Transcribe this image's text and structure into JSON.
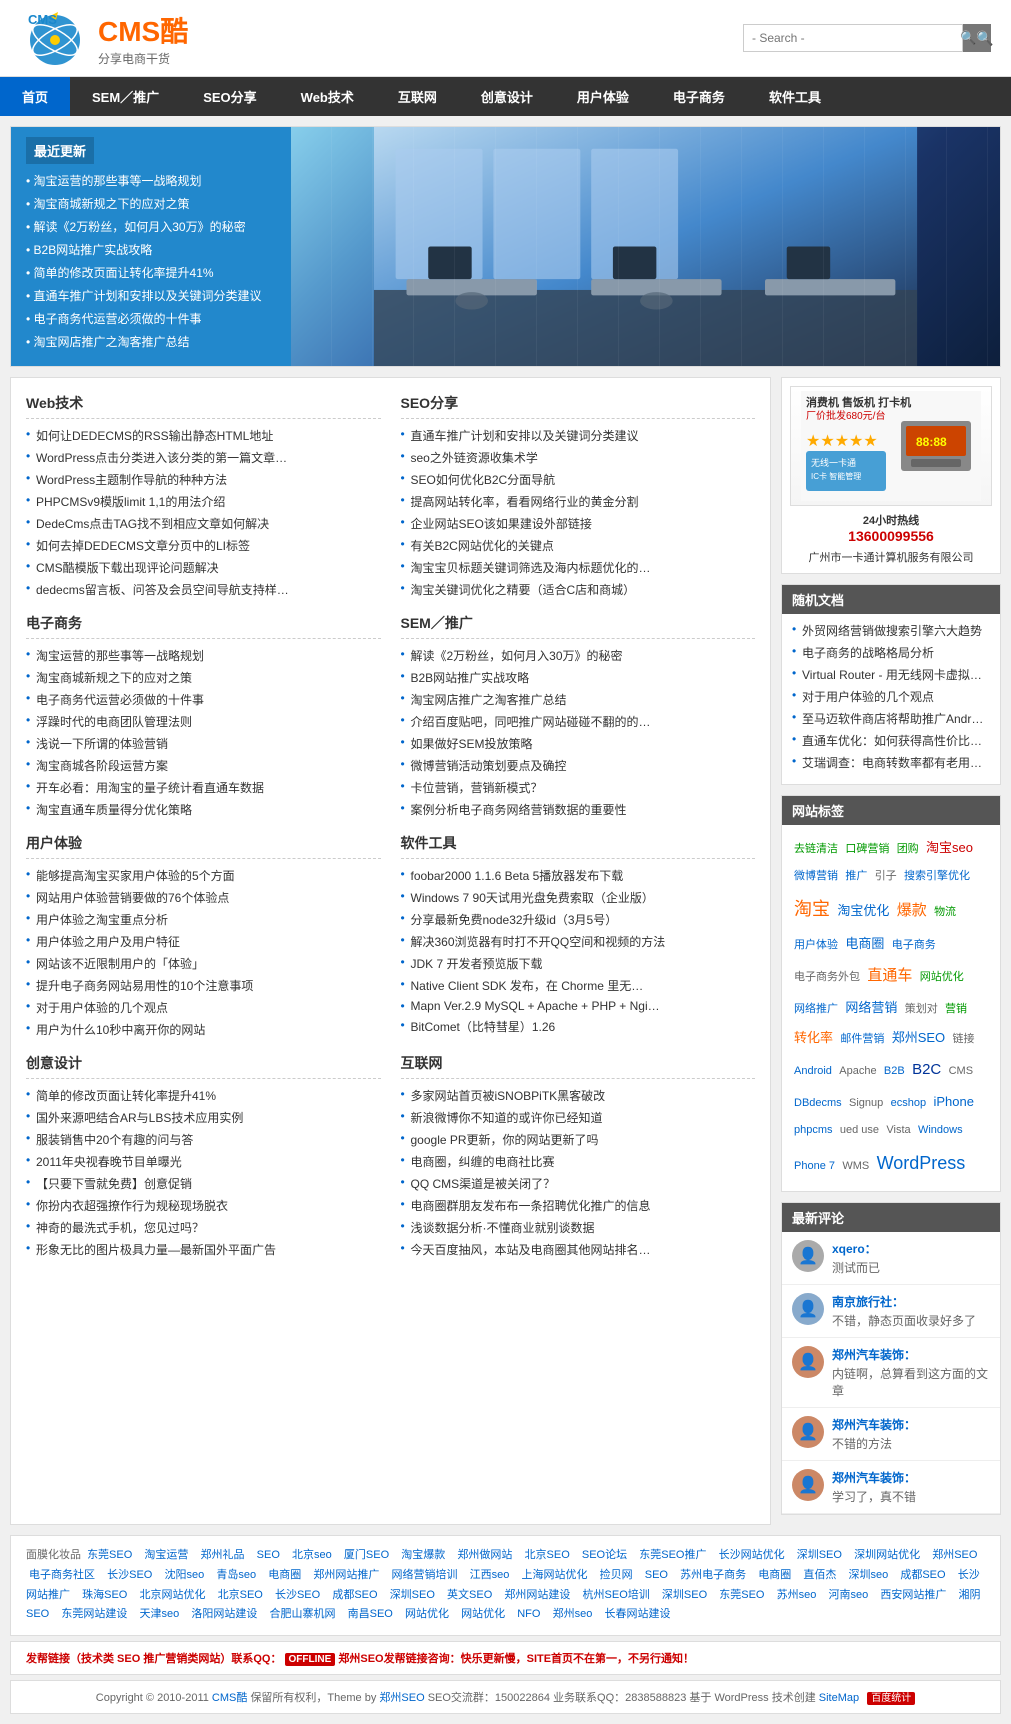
{
  "header": {
    "logo_cms": "CMS",
    "logo_ku": "酷",
    "tagline": "分享电商干货",
    "search_placeholder": "- Search -"
  },
  "nav": {
    "items": [
      {
        "label": "首页",
        "active": true
      },
      {
        "label": "SEM／推广"
      },
      {
        "label": "SEO分享"
      },
      {
        "label": "Web技术"
      },
      {
        "label": "互联网"
      },
      {
        "label": "创意设计"
      },
      {
        "label": "用户体验"
      },
      {
        "label": "电子商务"
      },
      {
        "label": "软件工具"
      }
    ]
  },
  "featured": {
    "section_title": "最近更新",
    "items": [
      "淘宝运营的那些事等一战略规划",
      "淘宝商城新规之下的应对之策",
      "解读《2万粉丝，如何月入30万》的秘密",
      "B2B网站推广实战攻略",
      "简单的修改页面让转化率提升41%",
      "直通车推广计划和安排以及关键词分类建议",
      "电子商务代运营必须做的十件事",
      "淘宝网店推广之淘客推广总结"
    ]
  },
  "sections": {
    "web_tech": {
      "title": "Web技术",
      "items": [
        "如何让DEDECMS的RSS输出静态HTML地址",
        "WordPress点击分类进入该分类的第一篇文章…",
        "WordPress主题制作导航的种种方法",
        "PHPCMSv9模版limit 1,1的用法介绍",
        "DedeCms点击TAG找不到相应文章如何解决",
        "如何去掉DEDECMS文章分页中的LI标签",
        "CMS酷模版下载出现评论问题解决",
        "dedecms留言板、问答及会员空间导航支持样…"
      ]
    },
    "seo": {
      "title": "SEO分享",
      "items": [
        "直通车推广计划和安排以及关键词分类建议",
        "seo之外链资源收集术学",
        "SEO如何优化B2C分面导航",
        "提高网站转化率，看看网络行业的黄金分割",
        "企业网站SEO该如果建设外部链接",
        "有关B2C网站优化的关键点",
        "淘宝宝贝标题关键词筛选及海内标题优化的…",
        "淘宝关键词优化之精要（适合C店和商城）"
      ]
    },
    "ecommerce": {
      "title": "电子商务",
      "items": [
        "淘宝运营的那些事等一战略规划",
        "淘宝商城新规之下的应对之策",
        "电子商务代运营必须做的十件事",
        "浮躁时代的电商团队管理法则",
        "浅说一下所谓的体验营销",
        "淘宝商城各阶段运营方案",
        "开车必看：用淘宝的量子统计看直通车数据",
        "淘宝直通车质量得分优化策略"
      ]
    },
    "sem": {
      "title": "SEM／推广",
      "items": [
        "解读《2万粉丝，如何月入30万》的秘密",
        "B2B网站推广实战攻略",
        "淘宝网店推广之淘客推广总结",
        "介绍百度贴吧，同吧推广网站碰碰不翻的的…",
        "如果做好SEM投放策略",
        "微博营销活动策划要点及确控",
        "卡位营销，营销新模式？",
        "案例分析电子商务网络营销数据的重要性"
      ]
    },
    "ux": {
      "title": "用户体验",
      "items": [
        "能够提高淘宝买家用户体验的5个方面",
        "网站用户体验营销要做的76个体验点",
        "用户体验之淘宝重点分析",
        "用户体验之用户及用户特征",
        "网站该不近限制用户的「体验」",
        "提升电子商务网站易用性的10个注意事项",
        "对于用户体验的几个观点",
        "用户为什么10秒中离开你的网站"
      ]
    },
    "software": {
      "title": "软件工具",
      "items": [
        "foobar2000 1.1.6 Beta 5播放器发布下载",
        "Windows 7 90天试用光盘免费索取（企业版）",
        "分享最新免费node32升级id（3月5号）",
        "解决360浏览器有时打不开QQ空间和视频的方法",
        "JDK 7 开发者预览版下载",
        "Native Client SDK 发布，在 Chorme 里无…",
        "Mapn Ver.2.9 MySQL + Apache + PHP + Ngi…",
        "BitComet（比特彗星）1.26"
      ]
    },
    "creative": {
      "title": "创意设计",
      "items": [
        "简单的修改页面让转化率提升41%",
        "国外来源吧结合AR与LBS技术应用实例",
        "服装销售中20个有趣的问与答",
        "2011年央视春晚节目单曝光",
        "【只要下雪就免费】创意促销",
        "你扮内衣超强撩作行为规秘现场脱衣",
        "神奇的最洗式手机，您见过吗？",
        "形象无比的图片极具力量—最新国外平面广告"
      ]
    },
    "internet": {
      "title": "互联网",
      "items": [
        "多家网站首页被iSNOBPiTK黑客破改",
        "新浪微博你不知道的或许你已经知道",
        "google PR更新，你的网站更新了吗",
        "电商圈，纠缠的电商社比赛",
        "QQ CMS渠道是被关闭了？",
        "电商圈群朋友发布布一条招聘优化推广的信息",
        "浅谈数据分析·不懂商业就别谈数据",
        "今天百度抽风，本站及电商圈其他网站排名…"
      ]
    }
  },
  "sidebar": {
    "ad": {
      "title": "消费机 售饭机 打卡机",
      "subtitle": "厂价批发680元/台",
      "hotline_label": "24小时热线",
      "hotline": "13600099556",
      "company": "广州市一卡通计算机服务有限公司",
      "wireless_label": "无线一卡通",
      "stars": "★★★★★"
    },
    "random_docs": {
      "title": "随机文档",
      "items": [
        "外贸网络营销做搜索引擎六大趋势",
        "电子商务的战略格局分析",
        "Virtual Router - 用无线网卡虚拟出 WiFi …",
        "对于用户体验的几个观点",
        "至马迈软件商店将帮助推广Android应用软件",
        "直通车优化：如何获得高性价比流量",
        "艾瑞调查：电商转数率都有老用户决定"
      ]
    },
    "tags": {
      "title": "网站标签",
      "items": [
        {
          "text": "去链清洁",
          "color": "green",
          "size": "sm"
        },
        {
          "text": "口碑营销",
          "color": "green",
          "size": "sm"
        },
        {
          "text": "团购",
          "color": "green",
          "size": "sm"
        },
        {
          "text": "淘宝seo",
          "color": "red",
          "size": "md"
        },
        {
          "text": "微博营销",
          "color": "blue",
          "size": "sm"
        },
        {
          "text": "推广",
          "color": "blue",
          "size": "sm"
        },
        {
          "text": "引子",
          "color": "gray",
          "size": "sm"
        },
        {
          "text": "搜索引擎优化",
          "color": "blue",
          "size": "sm"
        },
        {
          "text": "淘宝",
          "color": "orange",
          "size": "xl"
        },
        {
          "text": "淘宝优化",
          "color": "blue",
          "size": "md"
        },
        {
          "text": "爆款",
          "color": "orange",
          "size": "lg"
        },
        {
          "text": "物流",
          "color": "green",
          "size": "sm"
        },
        {
          "text": "用户体验",
          "color": "blue",
          "size": "sm"
        },
        {
          "text": "电商圈",
          "color": "blue",
          "size": "md"
        },
        {
          "text": "电子商务",
          "color": "blue",
          "size": "sm"
        },
        {
          "text": "电子商务外包",
          "color": "gray",
          "size": "sm"
        },
        {
          "text": "直通车",
          "color": "orange",
          "size": "lg"
        },
        {
          "text": "网站优化",
          "color": "green",
          "size": "sm"
        },
        {
          "text": "网络推广",
          "color": "blue",
          "size": "sm"
        },
        {
          "text": "网络营销",
          "color": "blue",
          "size": "md"
        },
        {
          "text": "策划对",
          "color": "gray",
          "size": "sm"
        },
        {
          "text": "营销",
          "color": "green",
          "size": "sm"
        },
        {
          "text": "转化率",
          "color": "orange",
          "size": "md"
        },
        {
          "text": "邮件营销",
          "color": "blue",
          "size": "sm"
        },
        {
          "text": "郑州SEO",
          "color": "blue",
          "size": "md"
        },
        {
          "text": "链接",
          "color": "gray",
          "size": "sm"
        },
        {
          "text": "Android",
          "color": "blue",
          "size": "sm"
        },
        {
          "text": "Apache",
          "color": "gray",
          "size": "sm"
        },
        {
          "text": "B2B",
          "color": "blue",
          "size": "sm"
        },
        {
          "text": "B2C",
          "color": "darkblue",
          "size": "lg"
        },
        {
          "text": "CMS",
          "color": "gray",
          "size": "sm"
        },
        {
          "text": "DBdecms",
          "color": "blue",
          "size": "sm"
        },
        {
          "text": "Signup",
          "color": "gray",
          "size": "sm"
        },
        {
          "text": "ecshop",
          "color": "blue",
          "size": "sm"
        },
        {
          "text": "iPhone",
          "color": "blue",
          "size": "md"
        },
        {
          "text": "phpcms",
          "color": "blue",
          "size": "sm"
        },
        {
          "text": "ued use",
          "color": "gray",
          "size": "sm"
        },
        {
          "text": "Vista",
          "color": "gray",
          "size": "sm"
        },
        {
          "text": "Windows",
          "color": "blue",
          "size": "sm"
        },
        {
          "text": "Phone 7",
          "color": "blue",
          "size": "sm"
        },
        {
          "text": "WMS",
          "color": "gray",
          "size": "sm"
        },
        {
          "text": "WordPress",
          "color": "blue",
          "size": "xl"
        }
      ]
    },
    "comments": {
      "title": "最新评论",
      "items": [
        {
          "author": "xqero：",
          "text": "测试而已",
          "avatar_color": "#aaa"
        },
        {
          "author": "南京旅行社：",
          "text": "不错，静态页面收录好多了",
          "avatar_color": "#88aacc"
        },
        {
          "author": "郑州汽车装饰：",
          "text": "内链啊，总算看到这方面的文章",
          "avatar_color": "#cc8866"
        },
        {
          "author": "郑州汽车装饰：",
          "text": "不错的方法",
          "avatar_color": "#cc8866"
        },
        {
          "author": "郑州汽车装饰：",
          "text": "学习了，真不错",
          "avatar_color": "#cc8866"
        }
      ]
    }
  },
  "footer_links": {
    "text": "面膜化妆品 东莞SEO 淘宝运营 郑州礼品 SEO 北京seo 厦门SEO 淘宝爆款 郑州做网站 北京SEO SEO论坛 东莞SEO推广 长沙网站优化 深圳SEO 深圳网站优化 郑州SEO 电子商务社区 长沙SEO 沈阳seo 青岛seo 电商圈 郑州网站推广 网络营销培训 江西seo 上海网站优化 捡贝网 SEO 苏州电子商务 电商圈 直佰杰 深圳seo 成都SEO 长沙网站推广 珠海SEO 北京网站优化 北京SEO 长沙SEO 成都SEO 深圳SEO 英文SEO 郑州网站建设 杭州SEO培训 深圳SEO 东莞SEO 苏州seo 河南seo 西安网站推广 湘阴SEO 东莞网站建设 天津seo 洛阳网站建设 合肥山寨机网 南昌SEO 网站优化 网站优化 NFO 郑州seo 长春网站建设"
  },
  "footer_notice": {
    "prefix": "发帮链接（技术类 SEO 推广营销类网站）联系QQ：",
    "qq_status": "OFFLINE",
    "suffix": "郑州SEO发帮链接咨询：快乐更新慢，SITE首页不在第一，不另行通知！"
  },
  "footer_bottom": {
    "copyright": "Copyright © 2010-2011",
    "site_name": "CMS酷",
    "rights": "保留所有权利，Theme by",
    "theme_author": "郑州SEO",
    "qq_label": "SEO交流群：150022864 业务联系QQ：2838588823",
    "powered": "基于 WordPress 技术创建",
    "sitemap": "SiteMap"
  }
}
